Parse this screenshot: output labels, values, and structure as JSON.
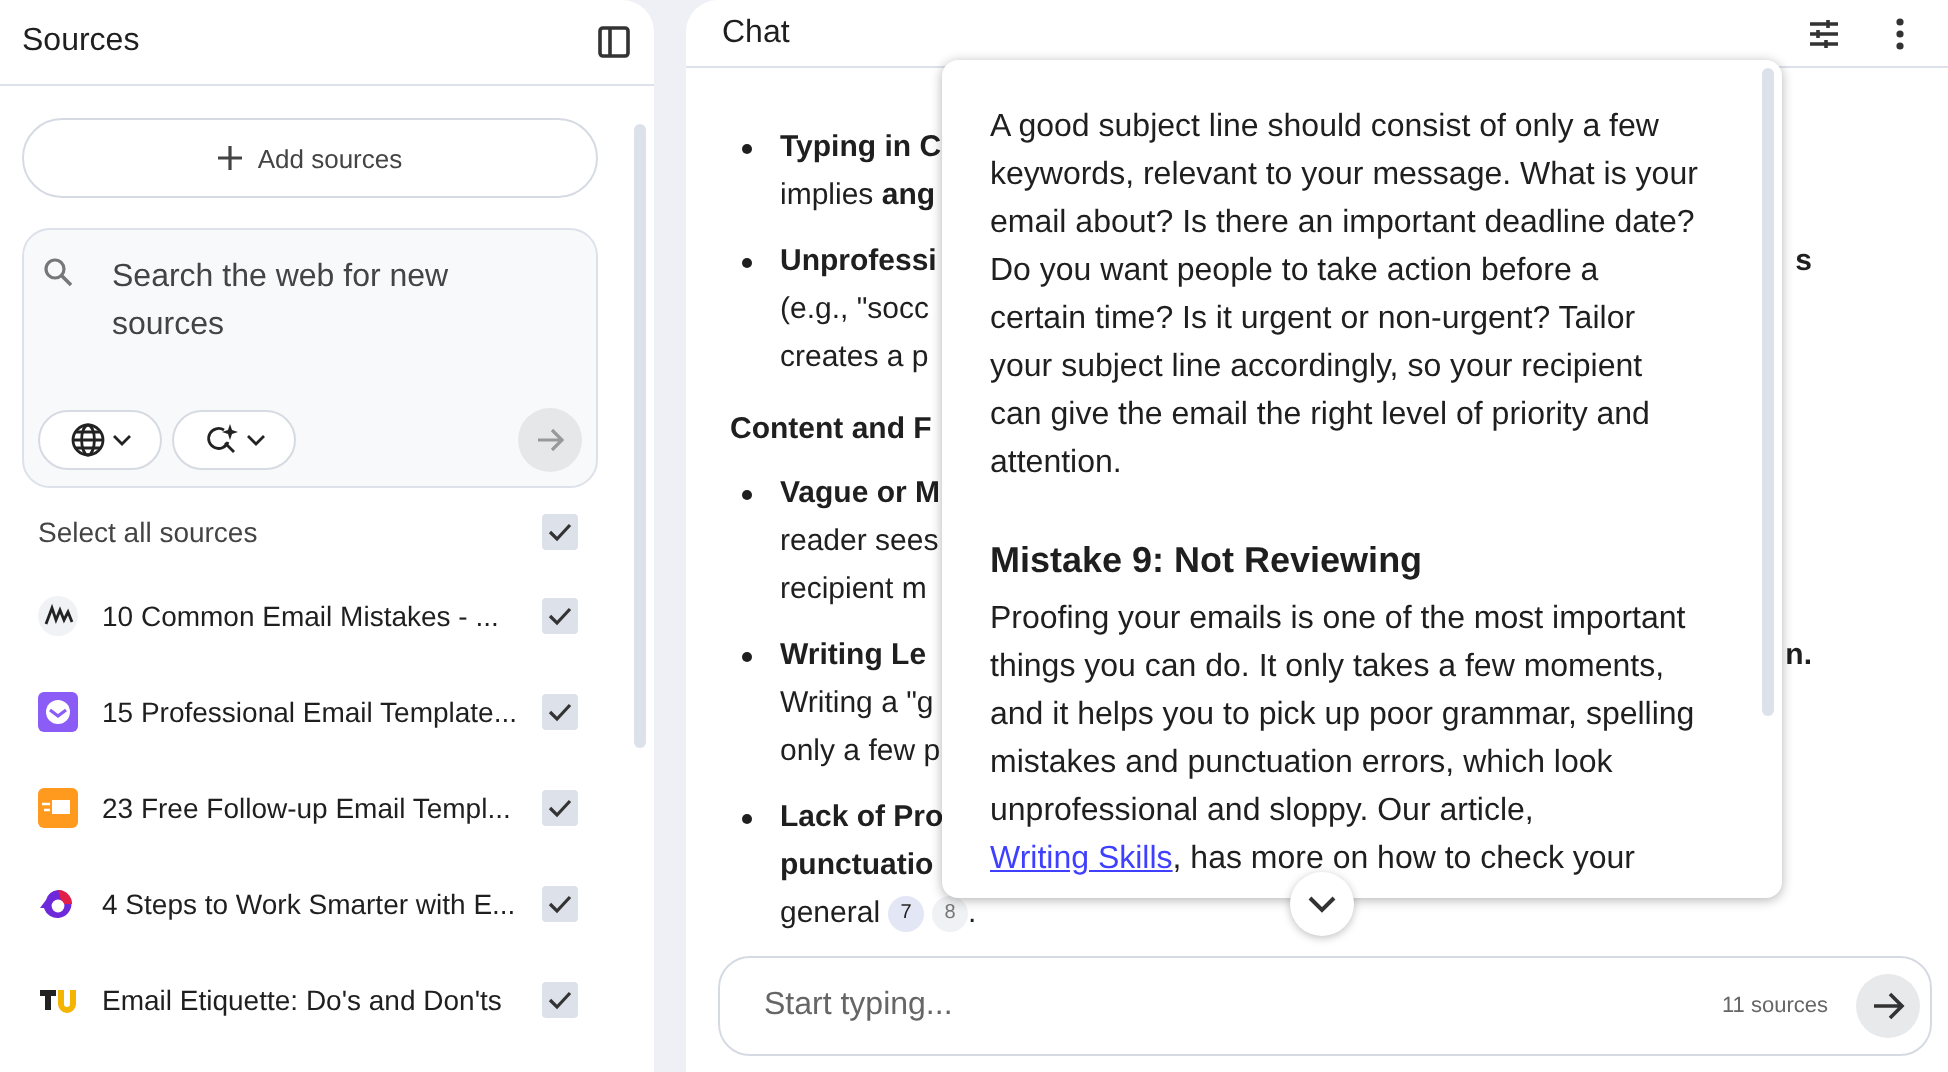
{
  "sidebar": {
    "title": "Sources",
    "add_button": "Add sources",
    "search": {
      "placeholder": "Search the web for new sources"
    },
    "select_all": {
      "label": "Select all sources",
      "checked": true
    },
    "sources": [
      {
        "title": "10 Common Email Mistakes - ...",
        "checked": true
      },
      {
        "title": "15 Professional Email Template...",
        "checked": true
      },
      {
        "title": "23 Free Follow-up Email Templ...",
        "checked": true
      },
      {
        "title": "4 Steps to Work Smarter with E...",
        "checked": true
      },
      {
        "title": "Email Etiquette: Do's and Don'ts",
        "checked": true
      }
    ]
  },
  "chat": {
    "title": "Chat",
    "content": [
      {
        "kind": "bullet",
        "lines": [
          {
            "text": "Typing in C",
            "bold": true
          },
          {
            "text": "implies **ang**",
            "bold": false
          }
        ]
      },
      {
        "kind": "bullet",
        "lines": [
          {
            "text": "Unprofessi",
            "bold": true,
            "right": "s"
          },
          {
            "text": "(e.g., \"socc",
            "bold": false
          },
          {
            "text": "creates a p",
            "bold": false
          }
        ]
      },
      {
        "kind": "heading",
        "lines": [
          {
            "text": "Content and F",
            "bold": true
          }
        ]
      },
      {
        "kind": "bullet",
        "lines": [
          {
            "text": "Vague or M",
            "bold": true
          },
          {
            "text": "reader sees",
            "bold": false
          },
          {
            "text": "recipient m",
            "bold": false
          }
        ]
      },
      {
        "kind": "bullet",
        "lines": [
          {
            "text": "Writing Le",
            "bold": true,
            "right": "n."
          },
          {
            "text": "Writing a \"g",
            "bold": false
          },
          {
            "text": "only a few p",
            "bold": false
          }
        ]
      },
      {
        "kind": "bullet",
        "lines": [
          {
            "text": "Lack of Pro",
            "bold": true
          },
          {
            "text": "punctuatio",
            "bold": true
          },
          {
            "text": "general",
            "bold": false,
            "citations": [
              {
                "label": "7",
                "selected": true
              },
              {
                "label": "8",
                "selected": false
              }
            ],
            "after": "."
          }
        ]
      }
    ],
    "popup": {
      "paragraph": "A good subject line should consist of only a few keywords, relevant to your message. What is your email about? Is there an important deadline date? Do you want people to take action before a certain time? Is it urgent or non-urgent? Tailor your subject line accordingly, so your recipient can give the email the right level of priority and attention.",
      "heading": "Mistake 9: Not Reviewing",
      "paragraph_2": "Proofing your emails is one of the most important things you can do. It only takes a few moments, and it helps you to pick up poor grammar, spelling mistakes and punctuation errors, which look unprofessional and sloppy. Our article,",
      "link": "Writing Skills",
      "after_link": ", has more on how to check your"
    },
    "input": {
      "placeholder": "Start typing...",
      "source_count": "11 sources"
    }
  }
}
